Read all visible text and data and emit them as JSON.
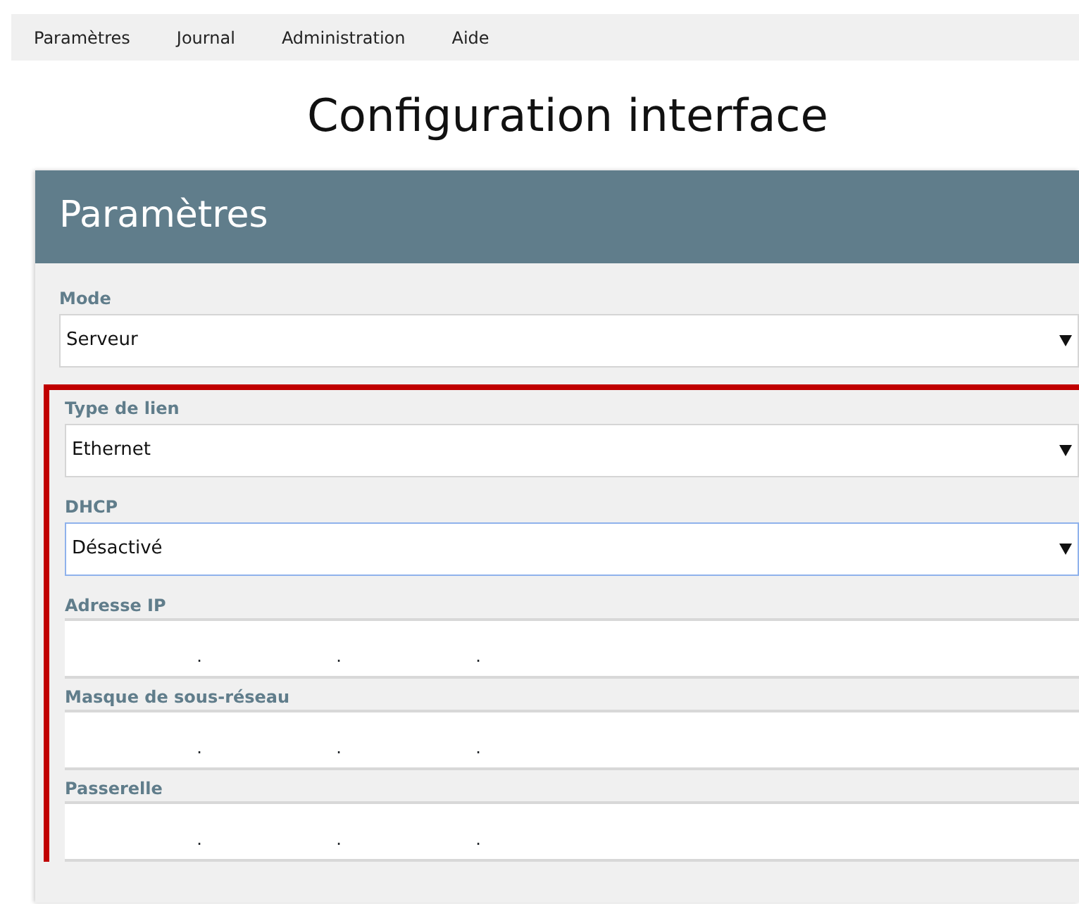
{
  "menu": [
    {
      "label": "Paramètres"
    },
    {
      "label": "Journal"
    },
    {
      "label": "Administration"
    },
    {
      "label": "Aide"
    }
  ],
  "page_title": "Configuration interface",
  "panel": {
    "title": "Paramètres",
    "fields": [
      {
        "kind": "select",
        "label": "Mode",
        "value": "Serveur",
        "focused": false
      }
    ],
    "highlighted_group": {
      "highlighted": true,
      "fields": [
        {
          "kind": "select",
          "label": "Type de lien",
          "value": "Ethernet",
          "focused": false
        },
        {
          "kind": "select",
          "label": "DHCP",
          "value": "Désactivé",
          "focused": true
        },
        {
          "kind": "ip",
          "label": "Adresse IP",
          "separators": [
            ".",
            ".",
            "."
          ]
        },
        {
          "kind": "ip",
          "label": "Masque de sous-réseau",
          "separators": [
            ".",
            ".",
            "."
          ]
        },
        {
          "kind": "ip",
          "label": "Passerelle",
          "separators": [
            ".",
            ".",
            "."
          ]
        }
      ]
    }
  }
}
